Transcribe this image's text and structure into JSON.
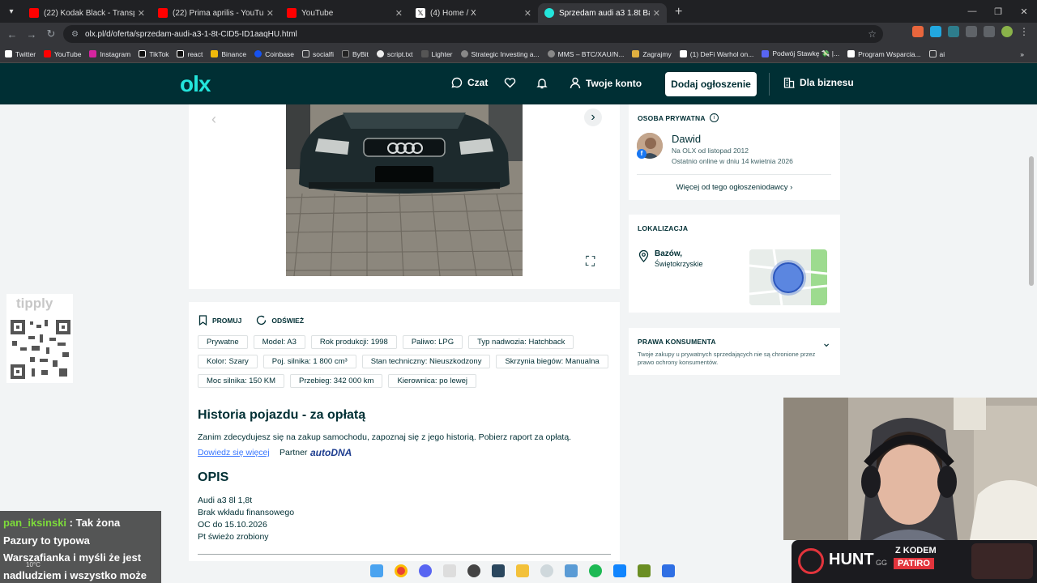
{
  "browser": {
    "tabs": [
      {
        "title": "(22) Kodak Black - Transportin'",
        "color": "#ff0000"
      },
      {
        "title": "(22) Prima aprilis - YouTube",
        "color": "#ff0000"
      },
      {
        "title": "YouTube",
        "color": "#ff0000"
      },
      {
        "title": "(4) Home / X",
        "color": "#ffffff"
      },
      {
        "title": "Sprzedam audi a3 1.8t Bazów -",
        "color": "#23e5db"
      }
    ],
    "url": "olx.pl/d/oferta/sprzedam-audi-a3-1-8t-CID5-ID1aaqHU.html",
    "bookmarks": [
      "Twitter",
      "YouTube",
      "Instagram",
      "TikTok",
      "react",
      "Binance",
      "Coinbase",
      "socialfi",
      "ByBit",
      "script.txt",
      "Lighter",
      "Strategic Investing a...",
      "MMS – BTC/XAU/N...",
      "Zagrajmy",
      "(1) DeFi Warhol on...",
      "Podwój Stawkę 💸 |...",
      "Program Wsparcia...",
      "ai"
    ]
  },
  "header": {
    "logo": "olx",
    "chat": "Czat",
    "account": "Twoje konto",
    "add_button": "Dodaj ogłoszenie",
    "business": "Dla biznesu"
  },
  "listing": {
    "promote": "PROMUJ",
    "refresh": "ODŚWIEŻ",
    "tags": [
      "Prywatne",
      "Model: A3",
      "Rok produkcji: 1998",
      "Paliwo: LPG",
      "Typ nadwozia: Hatchback",
      "Kolor: Szary",
      "Poj. silnika: 1 800 cm³",
      "Stan techniczny: Nieuszkodzony",
      "Skrzynia biegów: Manualna",
      "Moc silnika: 150 KM",
      "Przebieg: 342 000 km",
      "Kierownica: po lewej"
    ],
    "history_title": "Historia pojazdu - za opłatą",
    "history_desc": "Zanim zdecydujesz się na zakup samochodu, zapoznaj się z jego historią. Pobierz raport za opłatą.",
    "history_link": "Dowiedz się więcej",
    "partner": "Partner",
    "partner_name": "autoDNA",
    "desc_title": "OPIS",
    "desc_lines": [
      "Audi a3 8l 1,8t",
      "Brak wkładu finansowego",
      "OC do 15.10.2026",
      "Pt świeżo zrobiony"
    ]
  },
  "seller": {
    "label": "OSOBA PRYWATNA",
    "name": "Dawid",
    "since": "Na OLX od listopad 2012",
    "online": "Ostatnio online w dniu 14 kwietnia 2026",
    "more": "Więcej od tego ogłoszeniodawcy"
  },
  "location": {
    "label": "LOKALIZACJA",
    "city": "Bazów,",
    "region": "Świętokrzyskie"
  },
  "consumer": {
    "label": "PRAWA KONSUMENTA",
    "text": "Twoje zakupy u prywatnych sprzedających nie są chronione przez prawo ochrony konsumentów."
  },
  "overlay": {
    "tipply": "tipply",
    "chat_user": "pan_iksinski",
    "chat_msg_1": ": Tak żona",
    "chat_lines": [
      "Pazury to typowa",
      "Warszafianka i myśli że jest",
      "nadludziem i wszystko może"
    ],
    "hunt": "HUNT",
    "hunt_sub": "GG",
    "promo_1": "Z KODEM",
    "promo_2": "PATIRO",
    "temp": "10°C"
  }
}
